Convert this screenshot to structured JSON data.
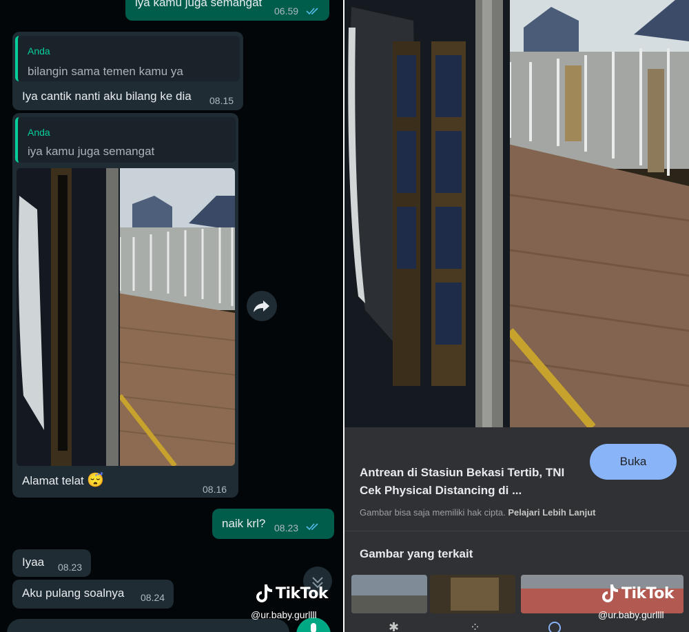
{
  "chat": {
    "messages": [
      {
        "text": "iya kamu juga semangat",
        "time": "06.59"
      },
      {
        "quote_author": "Anda",
        "quote_text": "bilangin sama temen kamu ya",
        "text": "Iya cantik nanti aku bilang ke dia",
        "time": "08.15"
      },
      {
        "quote_author": "Anda",
        "quote_text": "iya kamu juga semangat",
        "text": "Alamat telat",
        "emoji": "😴",
        "time": "08.16"
      },
      {
        "text": "naik krl?",
        "time": "08.23"
      },
      {
        "text": "Iyaa",
        "time": "08.23"
      },
      {
        "text": "Aku pulang soalnya",
        "time": "08.24"
      }
    ]
  },
  "lens": {
    "result_title_line1": "Antrean di Stasiun Bekasi Tertib, TNI",
    "result_title_line2": "Cek Physical Distancing di ...",
    "open_button": "Buka",
    "copyright_note": "Gambar bisa saja memiliki hak cipta.",
    "learn_more": "Pelajari Lebih Lanjut",
    "related_heading": "Gambar yang terkait"
  },
  "watermark": {
    "brand": "TikTok",
    "username": "@ur.baby.gurllll"
  },
  "colors": {
    "incoming_bubble": "#1f2c34",
    "outgoing_bubble": "#005c4b",
    "quote_accent": "#06cf9c",
    "lens_button": "#8ab4f8"
  },
  "icons": [
    "forward-icon",
    "double-check-icon",
    "scroll-down-icon",
    "tiktok-logo-icon",
    "mic-icon",
    "lens-nav-icon"
  ]
}
